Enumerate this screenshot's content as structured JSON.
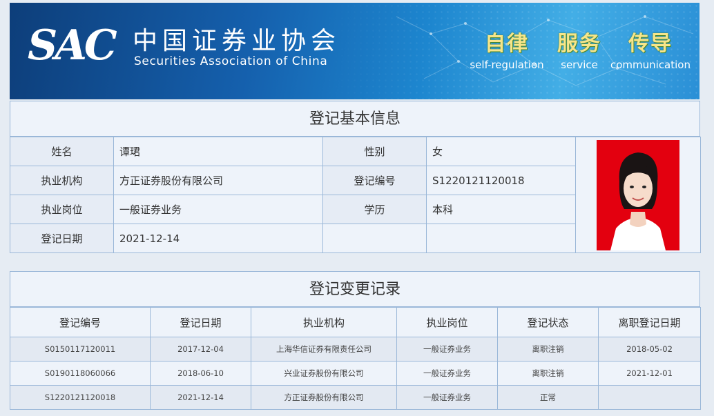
{
  "banner": {
    "logo_mark": "SAC",
    "org_name_cn": "中国证券业协会",
    "org_name_en": "Securities Association of China",
    "slogans": [
      {
        "zh": "自律",
        "en": "self-regulation"
      },
      {
        "zh": "服务",
        "en": "service"
      },
      {
        "zh": "传导",
        "en": "communication"
      }
    ],
    "colors": {
      "deep_blue": "#0d3e7a",
      "mid_blue": "#1d86cf",
      "slogan_yellow": "#f7e58a"
    }
  },
  "basic_info": {
    "title": "登记基本信息",
    "name_label": "姓名",
    "name_value": "谭珺",
    "gender_label": "性别",
    "gender_value": "女",
    "org_label": "执业机构",
    "org_value": "方正证券股份有限公司",
    "reg_no_label": "登记编号",
    "reg_no_value": "S1220121120018",
    "position_label": "执业岗位",
    "position_value": "一般证券业务",
    "edu_label": "学历",
    "edu_value": "本科",
    "date_label": "登记日期",
    "date_value": "2021-12-14",
    "photo_bg": "#e3000f"
  },
  "change_records": {
    "title": "登记变更记录",
    "columns": [
      "登记编号",
      "登记日期",
      "执业机构",
      "执业岗位",
      "登记状态",
      "离职登记日期"
    ],
    "rows": [
      [
        "S0150117120011",
        "2017-12-04",
        "上海华信证券有限责任公司",
        "一般证券业务",
        "离职注销",
        "2018-05-02"
      ],
      [
        "S0190118060066",
        "2018-06-10",
        "兴业证券股份有限公司",
        "一般证券业务",
        "离职注销",
        "2021-12-01"
      ],
      [
        "S1220121120018",
        "2021-12-14",
        "方正证券股份有限公司",
        "一般证券业务",
        "正常",
        ""
      ]
    ]
  }
}
